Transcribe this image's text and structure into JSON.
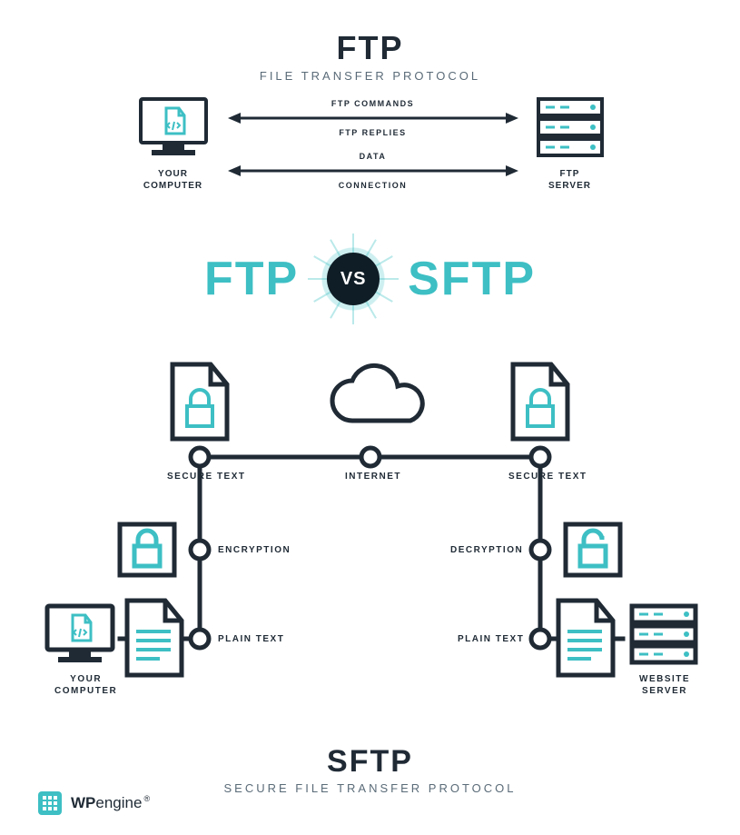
{
  "ftp": {
    "title": "FTP",
    "subtitle": "FILE TRANSFER PROTOCOL",
    "left_node": "YOUR\nCOMPUTER",
    "right_node": "FTP\nSERVER",
    "arrow_labels": [
      "FTP COMMANDS",
      "FTP REPLIES",
      "DATA",
      "CONNECTION"
    ]
  },
  "vs": {
    "left": "FTP",
    "badge": "VS",
    "right": "SFTP"
  },
  "sftp": {
    "title": "SFTP",
    "subtitle": "SECURE FILE TRANSFER PROTOCOL",
    "top_left_label": "SECURE TEXT",
    "top_center_label": "INTERNET",
    "top_right_label": "SECURE TEXT",
    "mid_left_label": "ENCRYPTION",
    "mid_right_label": "DECRYPTION",
    "bottom_left_label": "PLAIN TEXT",
    "bottom_right_label": "PLAIN TEXT",
    "left_node": "YOUR\nCOMPUTER",
    "right_node": "WEBSITE\nSERVER"
  },
  "footer": {
    "brand_bold": "WP",
    "brand_rest": "engine"
  },
  "colors": {
    "ink": "#1f2a35",
    "teal": "#3dbfc4"
  }
}
